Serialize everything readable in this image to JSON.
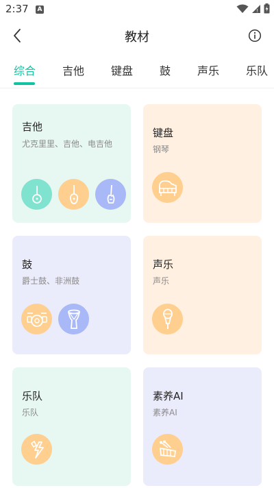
{
  "status": {
    "time": "2:37",
    "notification_letter": "A"
  },
  "header": {
    "title": "教材"
  },
  "tabs": [
    {
      "label": "综合",
      "active": true
    },
    {
      "label": "吉他",
      "active": false
    },
    {
      "label": "键盘",
      "active": false
    },
    {
      "label": "鼓",
      "active": false
    },
    {
      "label": "声乐",
      "active": false
    },
    {
      "label": "乐队",
      "active": false
    }
  ],
  "cards": [
    {
      "title": "吉他",
      "subtitle": "尤克里里、吉他、电吉他",
      "icons": [
        "ukulele-icon",
        "guitar-icon",
        "electric-guitar-icon"
      ]
    },
    {
      "title": "键盘",
      "subtitle": "钢琴",
      "icons": [
        "piano-icon"
      ]
    },
    {
      "title": "鼓",
      "subtitle": "爵士鼓、非洲鼓",
      "icons": [
        "drum-kit-icon",
        "djembe-icon"
      ]
    },
    {
      "title": "声乐",
      "subtitle": "声乐",
      "icons": [
        "microphone-icon"
      ]
    },
    {
      "title": "乐队",
      "subtitle": "乐队",
      "icons": [
        "band-lightning-icon"
      ]
    },
    {
      "title": "素养AI",
      "subtitle": "素养AI",
      "icons": [
        "xylophone-icon"
      ]
    }
  ],
  "colors": {
    "accent": "#12c3a1",
    "card_green": "#e7f8f2",
    "card_peach": "#fff0e1",
    "card_lavender": "#ebecfb"
  }
}
